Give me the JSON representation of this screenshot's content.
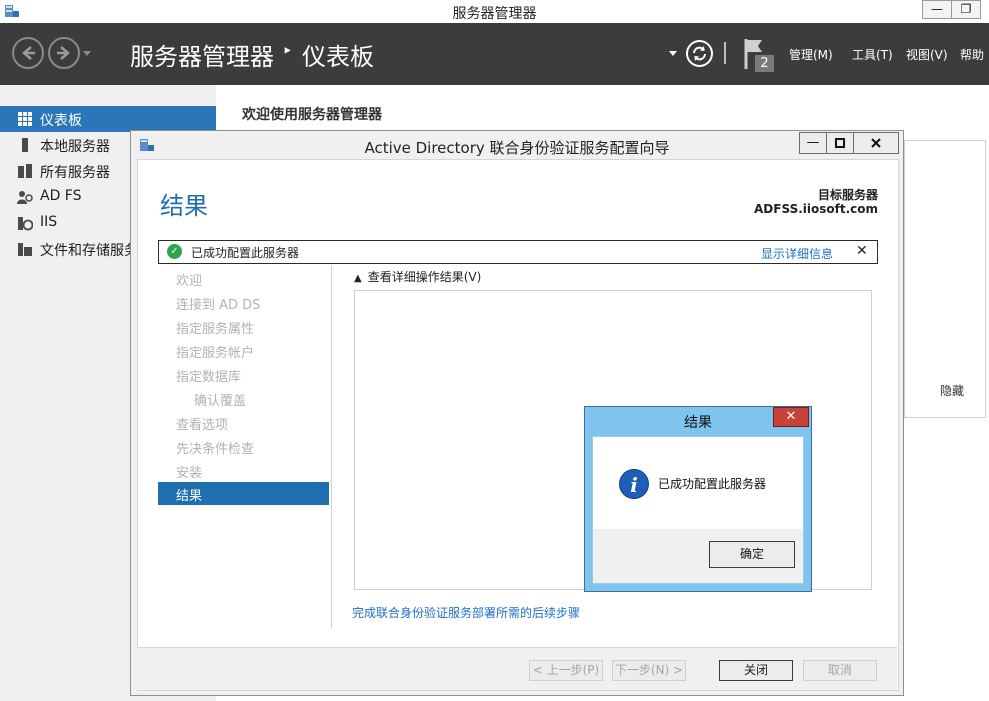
{
  "window": {
    "title": "服务器管理器",
    "minimize_glyph": "—",
    "maximize_glyph": "❐"
  },
  "header": {
    "breadcrumb_root": "服务器管理器",
    "breadcrumb_separator": "‣",
    "breadcrumb_current": "仪表板",
    "notification_count": "2",
    "menus": [
      "管理(M)",
      "工具(T)",
      "视图(V)",
      "帮助"
    ]
  },
  "sidebar": {
    "items": [
      {
        "label": "仪表板",
        "icon": "dashboard-icon",
        "active": true
      },
      {
        "label": "本地服务器",
        "icon": "server-icon",
        "active": false
      },
      {
        "label": "所有服务器",
        "icon": "servers-icon",
        "active": false
      },
      {
        "label": "AD FS",
        "icon": "adfs-icon",
        "active": false
      },
      {
        "label": "IIS",
        "icon": "iis-icon",
        "active": false
      },
      {
        "label": "文件和存储服务",
        "icon": "storage-icon",
        "active": false
      }
    ]
  },
  "background": {
    "welcome_title": "欢迎使用服务器管理器",
    "hide_link": "隐藏"
  },
  "wizard": {
    "title": "Active Directory 联合身份验证服务配置向导",
    "heading": "结果",
    "target_label": "目标服务器",
    "target_value": "ADFSS.iiosoft.com",
    "status_text": "已成功配置此服务器",
    "status_link": "显示详细信息",
    "steps": [
      {
        "label": "欢迎",
        "sub": false
      },
      {
        "label": "连接到 AD DS",
        "sub": false
      },
      {
        "label": "指定服务属性",
        "sub": false
      },
      {
        "label": "指定服务帐户",
        "sub": false
      },
      {
        "label": "指定数据库",
        "sub": false
      },
      {
        "label": "确认覆盖",
        "sub": true
      },
      {
        "label": "查看选项",
        "sub": false
      },
      {
        "label": "先决条件检查",
        "sub": false
      },
      {
        "label": "安装",
        "sub": false
      }
    ],
    "active_step": "结果",
    "detail_toggle": "查看详细操作结果(V)",
    "next_steps_link": "完成联合身份验证服务部署所需的后续步骤",
    "buttons": {
      "previous": "< 上一步(P)",
      "next": "下一步(N) >",
      "close": "关闭",
      "cancel": "取消"
    }
  },
  "messagebox": {
    "title": "结果",
    "message": "已成功配置此服务器",
    "ok": "确定"
  },
  "colors": {
    "accent": "#1f6fb0",
    "header_bg": "#3c3c3c",
    "link": "#1e6fc6"
  }
}
